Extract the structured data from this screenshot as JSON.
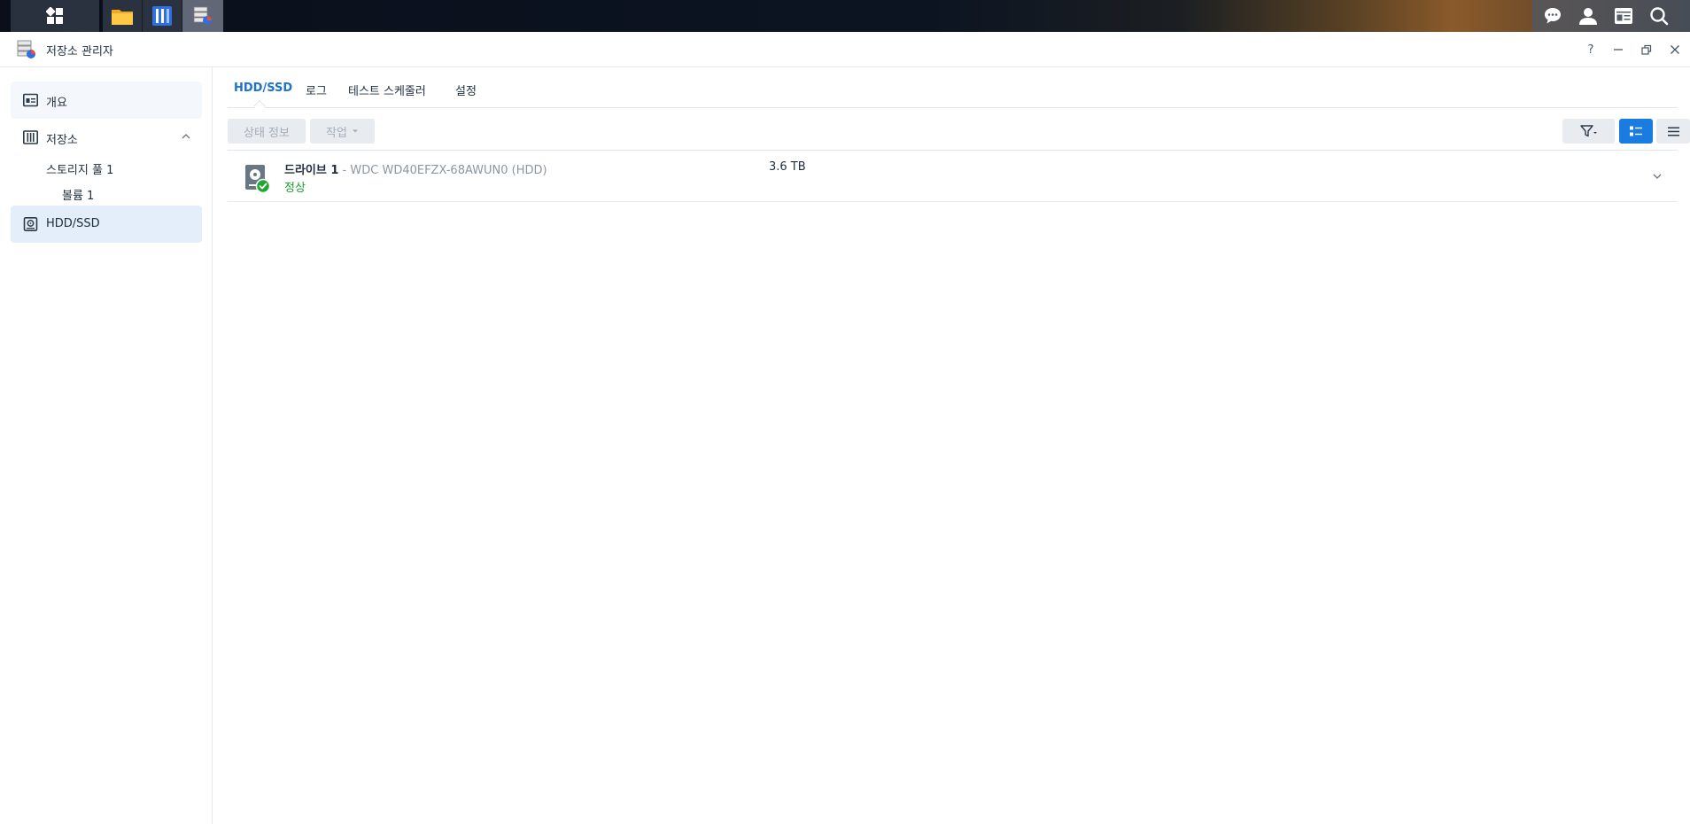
{
  "taskbar": {
    "icons": [
      "main-menu-icon",
      "file-station-icon",
      "control-panel-icon",
      "storage-manager-icon"
    ],
    "tray_icons": [
      "chat-icon",
      "user-icon",
      "widgets-icon",
      "search-icon"
    ]
  },
  "window": {
    "title": "저장소 관리자",
    "controls": {
      "help": "?"
    }
  },
  "sidebar": {
    "overview": "개요",
    "storage": "저장소",
    "storage_pool": "스토리지 풀 1",
    "volume": "볼륨 1",
    "hdd_ssd": "HDD/SSD"
  },
  "tabs": {
    "hdd_ssd": "HDD/SSD",
    "log": "로그",
    "test_scheduler": "테스트 스케줄러",
    "settings": "설정"
  },
  "toolbar": {
    "status_info": "상태 정보",
    "action": "작업"
  },
  "drives": [
    {
      "name": "드라이브 1",
      "separator": " - ",
      "model": "WDC WD40EFZX-68AWUN0 (HDD)",
      "status": "정상",
      "size": "3.6 TB"
    }
  ],
  "colors": {
    "accent": "#1c73cf",
    "status_ok": "#1c9e2c",
    "selected_bg": "#e3eefa"
  }
}
